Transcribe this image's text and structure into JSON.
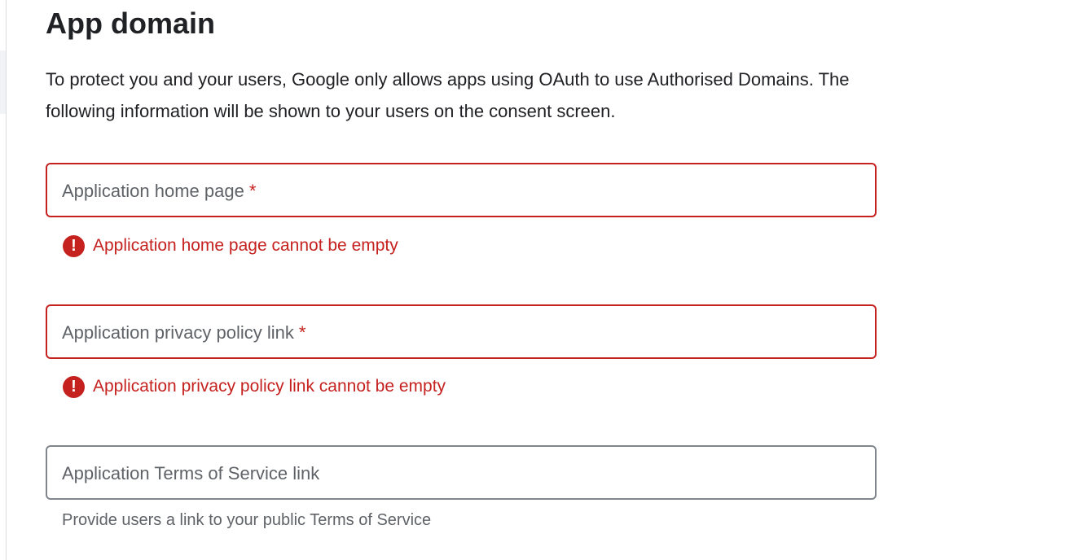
{
  "section": {
    "title": "App domain",
    "description": "To protect you and your users, Google only allows apps using OAuth to use Authorised Domains. The following information will be shown to your users on the consent screen."
  },
  "fields": [
    {
      "label": "Application home page",
      "required_mark": "*",
      "value": "",
      "error": "Application home page cannot be empty"
    },
    {
      "label": "Application privacy policy link",
      "required_mark": "*",
      "value": "",
      "error": "Application privacy policy link cannot be empty"
    },
    {
      "label": "Application Terms of Service link",
      "value": "",
      "hint": "Provide users a link to your public Terms of Service"
    }
  ],
  "icons": {
    "error": "error-exclamation-icon"
  },
  "colors": {
    "error": "#c5221f",
    "text": "#202124",
    "secondary_text": "#5f6368",
    "neutral_border": "#80868b"
  }
}
